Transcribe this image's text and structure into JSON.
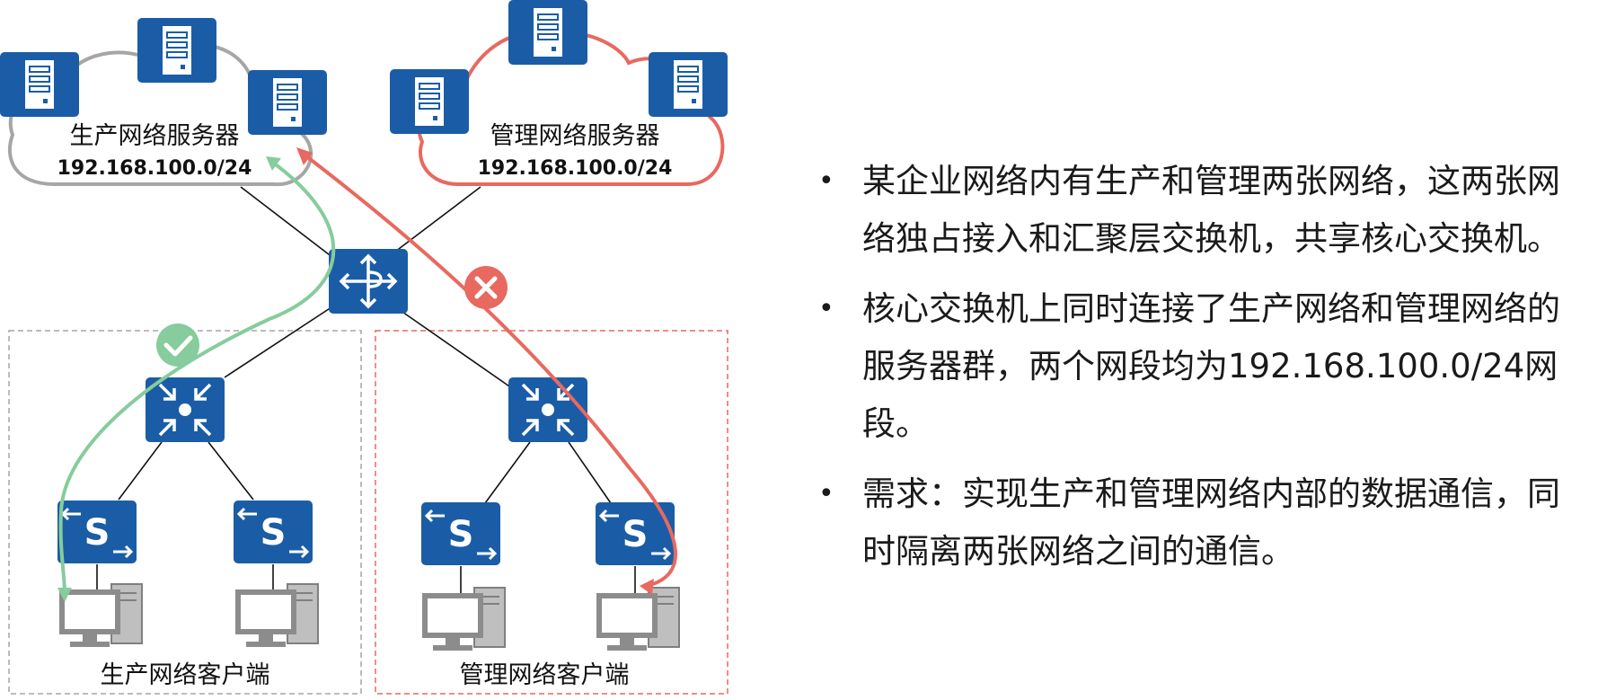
{
  "diagram": {
    "prod_server_label": "生产网络服务器",
    "prod_server_subnet": "192.168.100.0/24",
    "mgmt_server_label": "管理网络服务器",
    "mgmt_server_subnet": "192.168.100.0/24",
    "prod_client_label": "生产网络客户端",
    "mgmt_client_label": "管理网络客户端",
    "colors": {
      "device_blue": "#1a5da6",
      "prod_cloud": "#a6a6a6",
      "mgmt_cloud": "#e8695f",
      "allowed_path": "#86cc9c",
      "blocked_path": "#e8695f"
    }
  },
  "bullets": [
    "某企业网络内有生产和管理两张网络，这两张网络独占接入和汇聚层交换机，共享核心交换机。",
    "核心交换机上同时连接了生产网络和管理网络的服务器群，两个网段均为192.168.100.0/24网段。",
    "需求：实现生产和管理网络内部的数据通信，同时隔离两张网络之间的通信。"
  ]
}
